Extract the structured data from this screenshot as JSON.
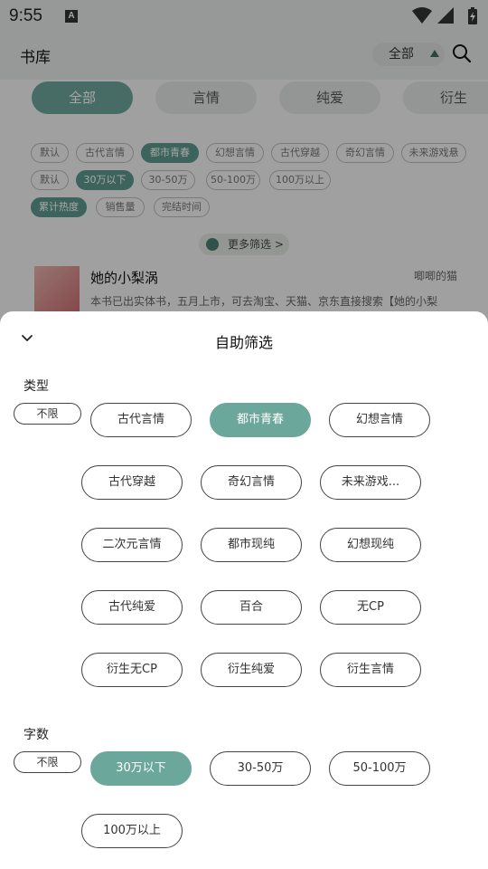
{
  "status": {
    "time": "9:55",
    "notif_letter": "A"
  },
  "header": {
    "title": "书库",
    "filter_label": "全部"
  },
  "tabs": [
    "全部",
    "言情",
    "纯爱",
    "衍生"
  ],
  "chip_rows": [
    [
      "默认",
      "古代言情",
      "都市青春",
      "幻想言情",
      "古代穿越",
      "奇幻言情",
      "未来游戏悬"
    ],
    [
      "默认",
      "30万以下",
      "30-50万",
      "50-100万",
      "100万以上"
    ],
    [
      "累计热度",
      "销售量",
      "完结时间"
    ]
  ],
  "more_filters": "更多筛选 >",
  "book": {
    "title": "她的小梨涡",
    "author": "唧唧的猫",
    "desc": "本书已出实体书，五月上市，可去淘宝、天猫、京东直接搜索【她的小梨"
  },
  "sheet": {
    "title": "自助筛选",
    "type_label": "类型",
    "type_nolimit": "不限",
    "type_options": [
      "古代言情",
      "都市青春",
      "幻想言情",
      "古代穿越",
      "奇幻言情",
      "未来游戏...",
      "二次元言情",
      "都市现纯",
      "幻想现纯",
      "古代纯爱",
      "百合",
      "无CP",
      "衍生无CP",
      "衍生纯爱",
      "衍生言情"
    ],
    "type_selected": "都市青春",
    "words_label": "字数",
    "words_nolimit": "不限",
    "words_options": [
      "30万以下",
      "30-50万",
      "50-100万",
      "100万以上"
    ],
    "words_selected": "30万以下"
  },
  "colors": {
    "accent": "#6ca79b",
    "accent_dark": "#3f6a60"
  }
}
